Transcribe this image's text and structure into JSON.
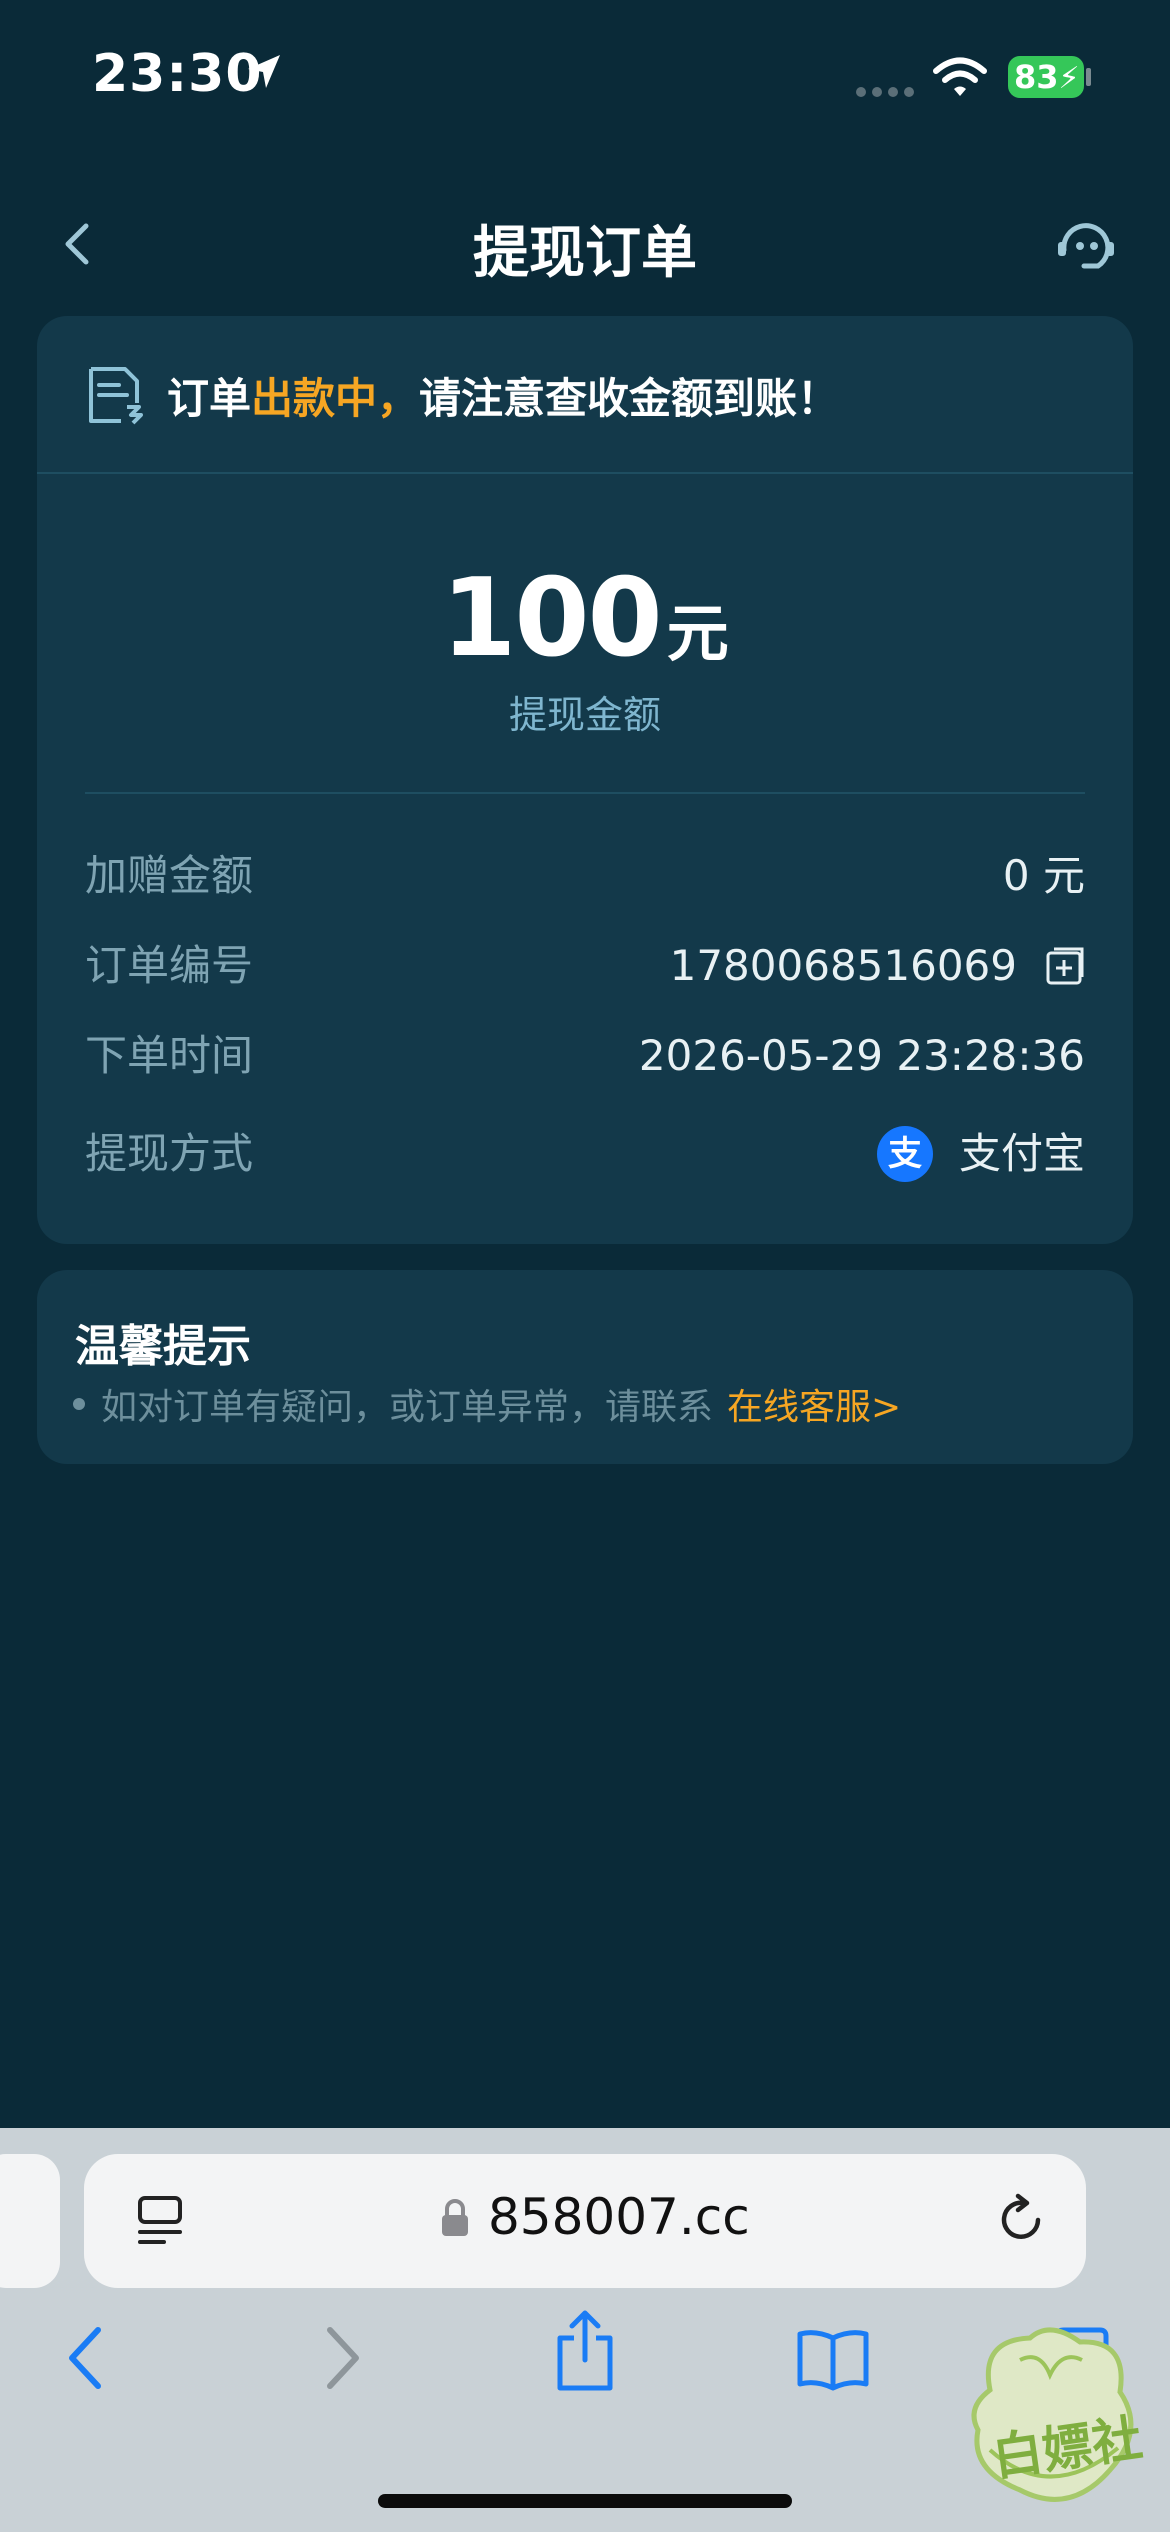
{
  "status_bar": {
    "time": "23:30",
    "battery": "83",
    "icons": [
      "location-arrow-icon",
      "signal-icon",
      "wifi-icon",
      "battery-charging-icon"
    ]
  },
  "nav": {
    "title": "提现订单",
    "back_icon": "chevron-left-icon",
    "service_icon": "customer-service-icon"
  },
  "order": {
    "notice_prefix": "订单",
    "notice_status": "出款中，",
    "notice_suffix": "请注意查收金额到账！",
    "amount": "100",
    "amount_unit": "元",
    "amount_label": "提现金额",
    "rows": [
      {
        "label": "加赠金额",
        "value": "0 元"
      },
      {
        "label": "订单编号",
        "value": "1780068516069"
      },
      {
        "label": "下单时间",
        "value": "2026-05-29 23:28:36"
      },
      {
        "label": "提现方式",
        "value": "支付宝"
      }
    ],
    "alipay_glyph": "支"
  },
  "tips": {
    "title": "温馨提示",
    "text": "如对订单有疑问，或订单异常，请联系",
    "link": "在线客服>"
  },
  "browser": {
    "url": "858007.cc",
    "toolbar": [
      "back-icon",
      "forward-icon",
      "share-icon",
      "bookmarks-icon",
      "tabs-icon"
    ]
  },
  "watermark": {
    "text": "白嫖社"
  },
  "colors": {
    "background": "#0a2a38",
    "card": "#13394a",
    "accent": "#f6a623",
    "muted": "#7fa4b3",
    "alipay": "#1677ff",
    "toolbar_blue": "#1a7cf5"
  }
}
